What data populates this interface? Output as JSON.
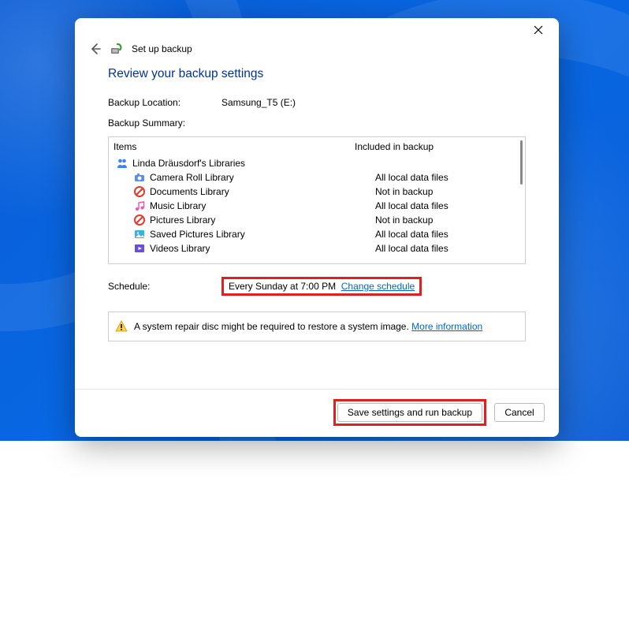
{
  "header": {
    "title": "Set up backup"
  },
  "heading": "Review your backup settings",
  "location": {
    "label": "Backup Location:",
    "value": "Samsung_T5 (E:)"
  },
  "summary": {
    "label": "Backup Summary:",
    "columns": {
      "items": "Items",
      "included": "Included in backup"
    },
    "rows": [
      {
        "indent": 0,
        "icon": "user-libs",
        "name": "Linda Dräusdorf's Libraries",
        "included": ""
      },
      {
        "indent": 1,
        "icon": "camera",
        "name": "Camera Roll Library",
        "included": "All local data files"
      },
      {
        "indent": 1,
        "icon": "forbid",
        "name": "Documents Library",
        "included": "Not in backup"
      },
      {
        "indent": 1,
        "icon": "music",
        "name": "Music Library",
        "included": "All local data files"
      },
      {
        "indent": 1,
        "icon": "forbid",
        "name": "Pictures Library",
        "included": "Not in backup"
      },
      {
        "indent": 1,
        "icon": "pictures",
        "name": "Saved Pictures Library",
        "included": "All local data files"
      },
      {
        "indent": 1,
        "icon": "video",
        "name": "Videos Library",
        "included": "All local data files"
      }
    ]
  },
  "schedule": {
    "label": "Schedule:",
    "value": "Every Sunday at 7:00 PM",
    "change_link": "Change schedule"
  },
  "info": {
    "text": "A system repair disc might be required to restore a system image. ",
    "link": "More information"
  },
  "footer": {
    "primary": "Save settings and run backup",
    "cancel": "Cancel"
  }
}
